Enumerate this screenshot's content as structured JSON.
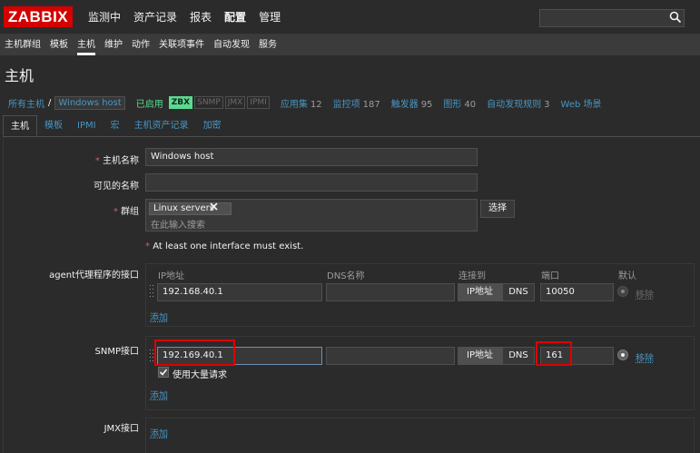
{
  "header": {
    "logo": "ZABBIX",
    "menu": [
      "监测中",
      "资产记录",
      "报表",
      "配置",
      "管理"
    ],
    "active_menu": "配置",
    "search_icon": "search-icon"
  },
  "submenu": [
    "主机群组",
    "模板",
    "主机",
    "维护",
    "动作",
    "关联项事件",
    "自动发现",
    "服务"
  ],
  "page_title": "主机",
  "breadcrumb": {
    "all_hosts": "所有主机",
    "separator": "/",
    "current_host": "Windows host",
    "status": "已启用",
    "availability": [
      "ZBX",
      "SNMP",
      "JMX",
      "IPMI"
    ],
    "items": [
      {
        "label": "应用集",
        "count": "12"
      },
      {
        "label": "监控项",
        "count": "187"
      },
      {
        "label": "触发器",
        "count": "95"
      },
      {
        "label": "图形",
        "count": "40"
      },
      {
        "label": "自动发现规则",
        "count": "3"
      },
      {
        "label": "Web 场景",
        "count": ""
      }
    ]
  },
  "tabs": [
    "主机",
    "模板",
    "IPMI",
    "宏",
    "主机资产记录",
    "加密"
  ],
  "form": {
    "host_name_label": "主机名称",
    "host_name_value": "Windows host",
    "visible_name_label": "可见的名称",
    "visible_name_value": "",
    "groups_label": "群组",
    "groups": [
      "Linux servers"
    ],
    "groups_placeholder": "在此输入搜索",
    "select_button": "选择",
    "required_note": "At least one interface must exist.",
    "required_mark": "*"
  },
  "interfaces": {
    "columns": [
      "IP地址",
      "DNS名称",
      "连接到",
      "端口",
      "默认"
    ],
    "connect_ip": "IP地址",
    "connect_dns": "DNS",
    "remove": "移除",
    "add": "添加",
    "agent": {
      "label": "agent代理程序的接口",
      "ip": "192.168.40.1",
      "dns": "",
      "port": "10050"
    },
    "snmp": {
      "label": "SNMP接口",
      "ip": "192.169.40.1",
      "dns": "",
      "port": "161",
      "bulk_label": "使用大量请求",
      "bulk_checked": true
    },
    "jmx": {
      "label": "JMX接口"
    }
  },
  "colors": {
    "accent_link": "#4796c4",
    "logo_red": "#d40000",
    "enabled_green": "#59db8f",
    "highlight_red": "#e00000"
  }
}
